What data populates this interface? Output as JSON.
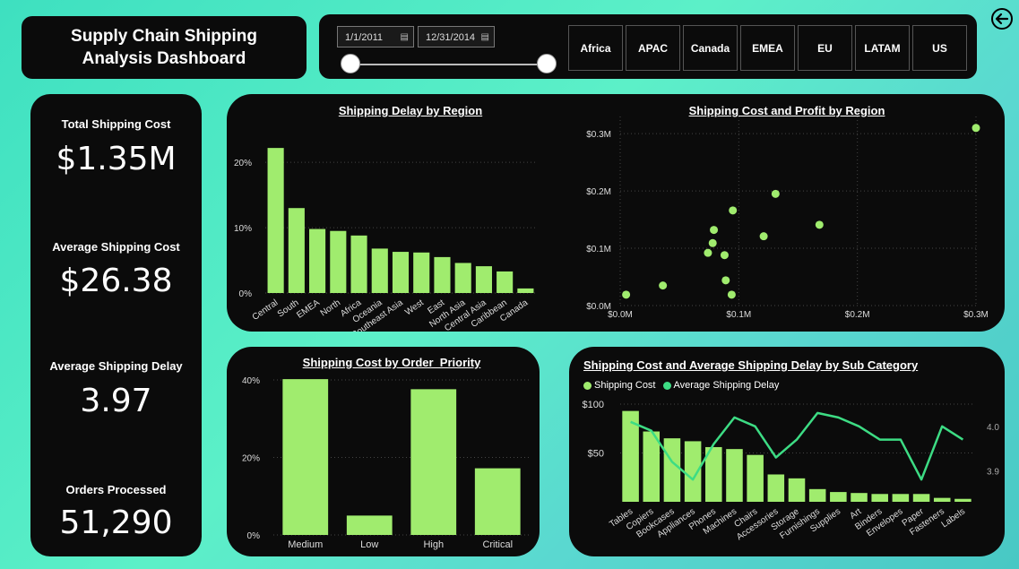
{
  "header": {
    "title": "Supply Chain Shipping Analysis Dashboard"
  },
  "filters": {
    "start_date": "1/1/2011",
    "end_date": "12/31/2014",
    "regions": [
      "Africa",
      "APAC",
      "Canada",
      "EMEA",
      "EU",
      "LATAM",
      "US"
    ]
  },
  "kpis": [
    {
      "label": "Total Shipping Cost",
      "value": "$1.35M"
    },
    {
      "label": "Average Shipping Cost",
      "value": "$26.38"
    },
    {
      "label": "Average Shipping Delay",
      "value": "3.97"
    },
    {
      "label": "Orders Processed",
      "value": "51,290"
    }
  ],
  "colors": {
    "bar": "#a0ec6e",
    "line": "#3ddc84",
    "panel": "#0b0b0b"
  },
  "chart_data": [
    {
      "id": "delay_by_region",
      "type": "bar",
      "title": "Shipping Delay by Region",
      "categories": [
        "Central",
        "South",
        "EMEA",
        "North",
        "Africa",
        "Oceania",
        "Southeast Asia",
        "West",
        "East",
        "North Asia",
        "Central Asia",
        "Caribbean",
        "Canada"
      ],
      "values": [
        22.2,
        13.0,
        9.8,
        9.5,
        8.8,
        6.8,
        6.3,
        6.2,
        5.5,
        4.6,
        4.1,
        3.3,
        0.7
      ],
      "yticks": [
        "0%",
        "10%",
        "20%"
      ],
      "ylim": [
        0,
        24
      ]
    },
    {
      "id": "cost_profit_by_region",
      "type": "scatter",
      "title": "Shipping Cost and Profit by Region",
      "x": [
        0.005,
        0.036,
        0.074,
        0.078,
        0.079,
        0.088,
        0.089,
        0.094,
        0.095,
        0.121,
        0.131,
        0.168,
        0.3
      ],
      "y": [
        0.019,
        0.035,
        0.092,
        0.109,
        0.132,
        0.088,
        0.044,
        0.019,
        0.166,
        0.121,
        0.195,
        0.141,
        0.31
      ],
      "xticks": [
        "$0.0M",
        "$0.1M",
        "$0.2M",
        "$0.3M"
      ],
      "yticks": [
        "$0.0M",
        "$0.1M",
        "$0.2M",
        "$0.3M"
      ],
      "xlim": [
        0,
        0.3
      ],
      "ylim": [
        0,
        0.33
      ]
    },
    {
      "id": "cost_by_priority",
      "type": "bar",
      "title": "Shipping Cost by Order_Priority",
      "categories": [
        "Medium",
        "Low",
        "High",
        "Critical"
      ],
      "values": [
        40.2,
        5.0,
        37.6,
        17.2
      ],
      "yticks": [
        "0%",
        "20%",
        "40%"
      ],
      "ylim": [
        0,
        43
      ]
    },
    {
      "id": "cost_delay_by_subcategory",
      "type": "bar",
      "title": "Shipping Cost and Average Shipping Delay by Sub Category",
      "categories": [
        "Tables",
        "Copiers",
        "Bookcases",
        "Appliances",
        "Phones",
        "Machines",
        "Chairs",
        "Accessories",
        "Storage",
        "Furnishings",
        "Supplies",
        "Art",
        "Binders",
        "Envelopes",
        "Paper",
        "Fasteners",
        "Labels"
      ],
      "series": [
        {
          "name": "Shipping Cost",
          "type": "bar",
          "values": [
            93,
            72,
            65,
            62,
            56,
            54,
            48,
            28,
            24,
            13,
            10,
            9,
            8,
            8,
            8,
            4,
            3
          ]
        },
        {
          "name": "Average Shipping Delay",
          "type": "line",
          "values": [
            4.01,
            3.99,
            3.92,
            3.88,
            3.96,
            4.02,
            4.0,
            3.93,
            3.97,
            4.03,
            4.02,
            4.0,
            3.97,
            3.97,
            3.88,
            4.0,
            3.97
          ]
        }
      ],
      "yticks": [
        "$50",
        "$100"
      ],
      "y2ticks": [
        "3.9",
        "4.0"
      ],
      "ylim": [
        0,
        100
      ],
      "y2lim": [
        3.83,
        4.05
      ]
    }
  ]
}
